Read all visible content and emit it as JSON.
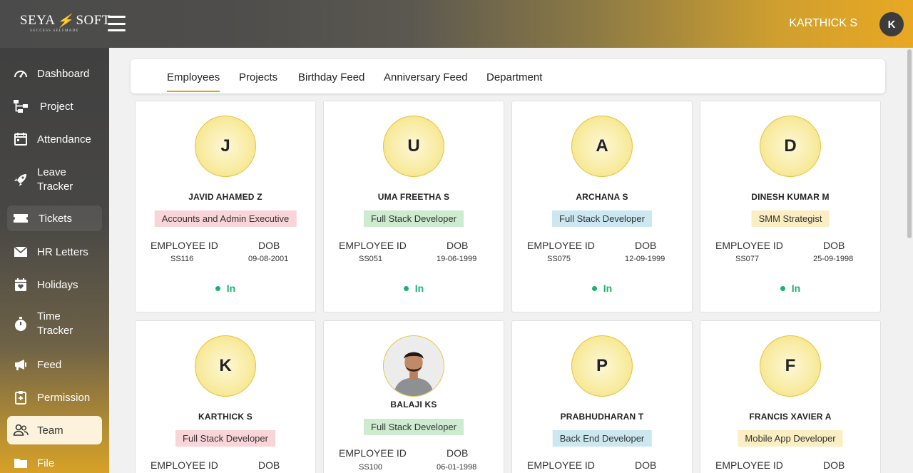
{
  "header": {
    "logo_left": "SEYA",
    "logo_right": "SOFT",
    "logo_tagline": "SUCCESS SELFMADE",
    "user_name": "KARTHICK S",
    "user_initial": "K"
  },
  "sidebar": {
    "items": [
      {
        "label": "Dashboard",
        "icon": "gauge-icon"
      },
      {
        "label": "Project",
        "icon": "sitemap-icon"
      },
      {
        "label": "Attendance",
        "icon": "calendar-icon"
      },
      {
        "label": "Leave Tracker",
        "icon": "rocket-icon"
      },
      {
        "label": "Tickets",
        "icon": "ticket-icon"
      },
      {
        "label": "HR Letters",
        "icon": "envelope-icon"
      },
      {
        "label": "Holidays",
        "icon": "calendar-heart-icon"
      },
      {
        "label": "Time Tracker",
        "icon": "stopwatch-icon"
      },
      {
        "label": "Feed",
        "icon": "megaphone-icon"
      },
      {
        "label": "Permission",
        "icon": "clipboard-icon"
      },
      {
        "label": "Team",
        "icon": "users-icon"
      },
      {
        "label": "File",
        "icon": "folder-icon"
      }
    ],
    "active": "Team"
  },
  "tabs": [
    "Employees",
    "Projects",
    "Birthday Feed",
    "Anniversary Feed",
    "Department"
  ],
  "active_tab": "Employees",
  "labels": {
    "employee_id": "EMPLOYEE ID",
    "dob": "DOB"
  },
  "employees": [
    {
      "initial": "J",
      "name": "JAVID AHAMED Z",
      "role": "Accounts and Admin Executive",
      "role_color": "pink",
      "id": "SS116",
      "dob": "09-08-2001",
      "status": "In"
    },
    {
      "initial": "U",
      "name": "UMA FREETHA S",
      "role": "Full Stack Developer",
      "role_color": "green",
      "id": "SS051",
      "dob": "19-06-1999",
      "status": "In"
    },
    {
      "initial": "A",
      "name": "ARCHANA S",
      "role": "Full Stack Developer",
      "role_color": "blue",
      "id": "SS075",
      "dob": "12-09-1999",
      "status": "In"
    },
    {
      "initial": "D",
      "name": "DINESH KUMAR M",
      "role": "SMM Strategist",
      "role_color": "yellow",
      "id": "SS077",
      "dob": "25-09-1998",
      "status": "In"
    },
    {
      "initial": "K",
      "name": "KARTHICK S",
      "role": "Full Stack Developer",
      "role_color": "pink",
      "id": "",
      "dob": "",
      "status": ""
    },
    {
      "initial": "",
      "name": "BALAJI KS",
      "role": "Full Stack Developer",
      "role_color": "green",
      "id": "SS100",
      "dob": "06-01-1998",
      "status": "",
      "photo": true
    },
    {
      "initial": "P",
      "name": "PRABHUDHARAN T",
      "role": "Back End Developer",
      "role_color": "blue",
      "id": "",
      "dob": "",
      "status": ""
    },
    {
      "initial": "F",
      "name": "FRANCIS XAVIER A",
      "role": "Mobile App Developer",
      "role_color": "yellow",
      "id": "",
      "dob": "",
      "status": ""
    }
  ]
}
